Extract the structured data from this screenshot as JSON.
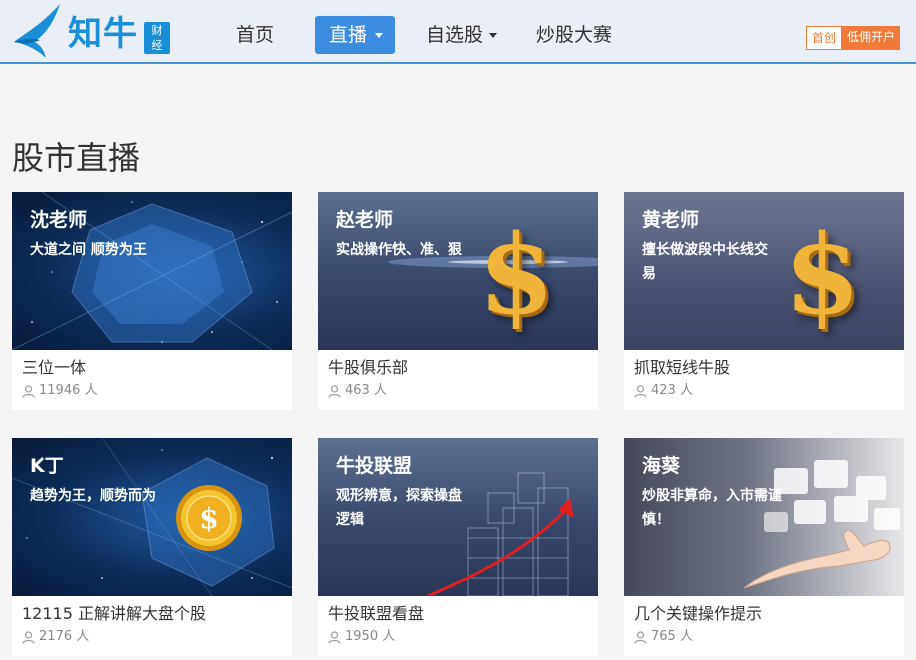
{
  "header": {
    "logo_text": "知牛",
    "logo_badge_top": "财",
    "logo_badge_bottom": "经",
    "nav": [
      {
        "label": "首页"
      },
      {
        "label": "直播"
      },
      {
        "label": "自选股"
      },
      {
        "label": "炒股大赛"
      }
    ],
    "open_account": {
      "prefix": "首创",
      "label": "低佣开户"
    },
    "colors": {
      "accent": "#3c8de0",
      "orange": "#f07a3a",
      "header_bg": "#eaeef6"
    }
  },
  "page_title": "股市直播",
  "cards": [
    {
      "teacher": "沈老师",
      "slogan": "大道之间 顺势为王",
      "title": "三位一体",
      "count": "11946 人",
      "thumb_icon": "hexagon-space-icon"
    },
    {
      "teacher": "赵老师",
      "slogan": "实战操作快、准、狠",
      "title": "牛股俱乐部",
      "count": "463 人",
      "thumb_icon": "gold-dollar-icon"
    },
    {
      "teacher": "黄老师",
      "slogan": "擅长做波段中长线交易",
      "title": "抓取短线牛股",
      "count": "423 人",
      "thumb_icon": "gold-dollar-icon"
    },
    {
      "teacher": "K丁",
      "slogan": "趋势为王，顺势而为",
      "title": "12115 正解讲解大盘个股",
      "count": "2176 人",
      "thumb_icon": "gold-coin-icon"
    },
    {
      "teacher": "牛投联盟",
      "slogan": "观形辨意，探索操盘逻辑",
      "title": "牛投联盟看盘",
      "count": "1950 人",
      "thumb_icon": "rising-chart-icon"
    },
    {
      "teacher": "海葵",
      "slogan": "炒股非算命，入市需谨慎！",
      "title": "几个关键操作提示",
      "count": "765 人",
      "thumb_icon": "hand-cubes-icon"
    }
  ]
}
